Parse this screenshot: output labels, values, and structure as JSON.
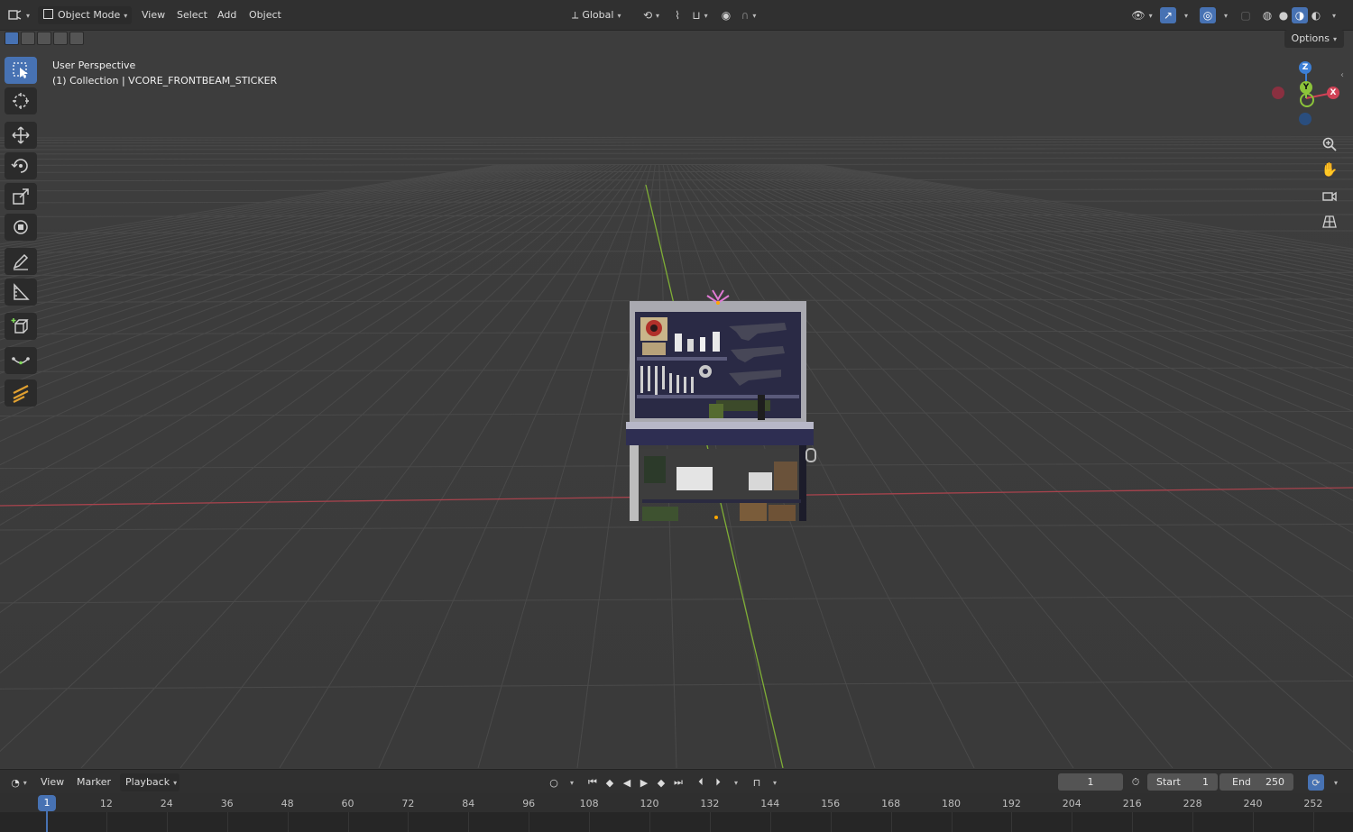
{
  "header": {
    "mode": "Object Mode",
    "menus": [
      "View",
      "Select",
      "Add",
      "Object"
    ],
    "transform_orientation": "Global",
    "options_label": "Options"
  },
  "viewport": {
    "perspective_label": "User Perspective",
    "collection_label": "(1) Collection | VCORE_FRONTBEAM_STICKER",
    "axes": {
      "z": "Z",
      "y": "Y",
      "x": "X"
    }
  },
  "toolbar": {
    "tools": [
      {
        "name": "select-box",
        "active": true
      },
      {
        "name": "cursor",
        "active": false
      },
      {
        "name": "move",
        "active": false
      },
      {
        "name": "rotate",
        "active": false
      },
      {
        "name": "scale",
        "active": false
      },
      {
        "name": "transform",
        "active": false
      },
      {
        "name": "annotate",
        "active": false
      },
      {
        "name": "measure",
        "active": false
      },
      {
        "name": "add-cube",
        "active": false
      },
      {
        "name": "curve",
        "active": false
      },
      {
        "name": "grease-pencil",
        "active": false
      }
    ]
  },
  "timeline": {
    "menus": [
      "View",
      "Marker",
      "Playback"
    ],
    "current_frame": "1",
    "start_label": "Start",
    "start_value": "1",
    "end_label": "End",
    "end_value": "250",
    "playhead": "1",
    "ticks": [
      "12",
      "24",
      "36",
      "48",
      "60",
      "72",
      "84",
      "96",
      "108",
      "120",
      "132",
      "144",
      "156",
      "168",
      "180",
      "192",
      "204",
      "216",
      "228",
      "240",
      "252"
    ]
  },
  "colors": {
    "accent": "#4772b3",
    "x_axis": "#d04256",
    "y_axis": "#8cc43a",
    "z_axis": "#3c7fd6"
  }
}
